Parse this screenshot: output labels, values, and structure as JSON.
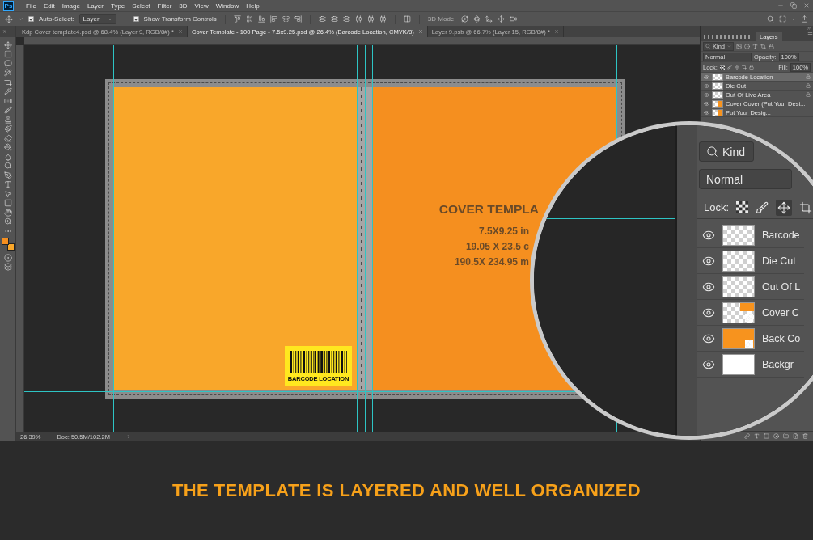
{
  "logo": "Ps",
  "menu": [
    "File",
    "Edit",
    "Image",
    "Layer",
    "Type",
    "Select",
    "Filter",
    "3D",
    "View",
    "Window",
    "Help"
  ],
  "options": {
    "auto_select": {
      "label": "Auto-Select:",
      "checked": true
    },
    "target": "Layer",
    "transform": {
      "label": "Show Transform Controls",
      "checked": true
    },
    "mode_3d": "3D Mode:"
  },
  "tabs": [
    {
      "label": "Kdp Cover template4.psd @ 68.4% (Layer 9, RGB/8#) *",
      "selected": false
    },
    {
      "label": "Cover Template - 100 Page - 7.5x9.25.psd @ 26.4% (Barcode Location, CMYK/8)",
      "selected": true
    },
    {
      "label": "Layer 9.psb @ 66.7% (Layer 15, RGB/8#) *",
      "selected": false
    }
  ],
  "document": {
    "title": "COVER TEMPLA",
    "sizes": [
      "7.5X9.25 in",
      "19.05 X 23.5 c",
      "190.5X 234.95 m"
    ],
    "barcode": "BARCODE LOCATION"
  },
  "status": {
    "zoom": "26.39%",
    "doc": "Doc: 50.5M/102.2M"
  },
  "layers_panel": {
    "tab": "Layers",
    "filter": "Kind",
    "blend": "Normal",
    "opacity_label": "Opacity:",
    "opacity": "100%",
    "lock_label": "Lock:",
    "fill_label": "Fill:",
    "fill": "100%",
    "layers": [
      {
        "name": "Barcode Location",
        "selected": true,
        "locked": true
      },
      {
        "name": "Die Cut",
        "selected": false,
        "locked": true
      },
      {
        "name": "Out Of Live Area",
        "selected": false,
        "locked": true
      },
      {
        "name": "Cover Cover (Put Your Desi...",
        "selected": false,
        "locked": false
      },
      {
        "name": "Put Your Desig...",
        "selected": false,
        "locked": false
      }
    ]
  },
  "magnifier": {
    "filter": "Kind",
    "blend": "Normal",
    "lock_label": "Lock:",
    "layers": [
      {
        "name": "Barcode",
        "kind": "transparent"
      },
      {
        "name": "Die Cut",
        "kind": "transparent"
      },
      {
        "name": "Out Of L",
        "kind": "transparent"
      },
      {
        "name": "Cover C",
        "kind": "cover"
      },
      {
        "name": "Back Co",
        "kind": "back"
      },
      {
        "name": "Backgr",
        "kind": "white"
      }
    ]
  },
  "banner": "THE TEMPLATE IS LAYERED AND WELL ORGANIZED"
}
